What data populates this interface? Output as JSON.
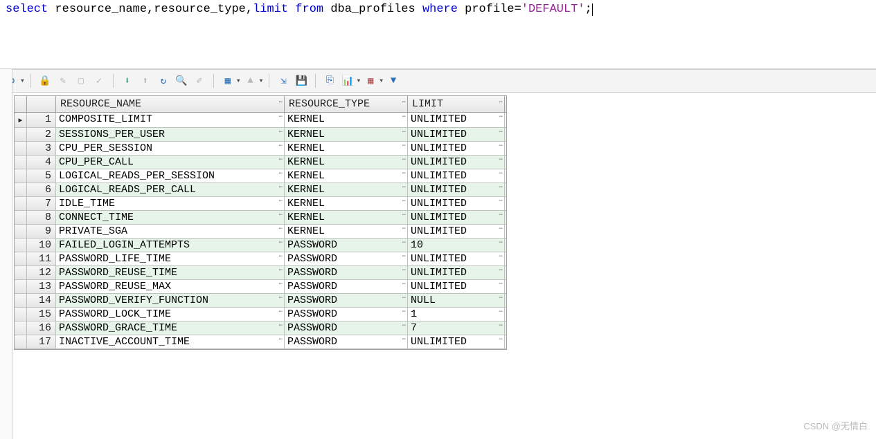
{
  "sql": {
    "tokens": [
      {
        "t": "select ",
        "c": "kw"
      },
      {
        "t": "resource_name,resource_type,",
        "c": "plain"
      },
      {
        "t": "limit ",
        "c": "kw"
      },
      {
        "t": "from ",
        "c": "kw"
      },
      {
        "t": "dba_profiles ",
        "c": "plain"
      },
      {
        "t": "where ",
        "c": "kw"
      },
      {
        "t": "profile=",
        "c": "plain"
      },
      {
        "t": "'DEFAULT'",
        "c": "str"
      },
      {
        "t": ";",
        "c": "plain"
      }
    ]
  },
  "toolbar": {
    "buttons": [
      {
        "name": "gear-icon",
        "color": "#2a6fb5",
        "char": "⚙",
        "drop": true
      },
      {
        "sep": true
      },
      {
        "name": "lock-icon",
        "color": "#b02020",
        "char": "🔒"
      },
      {
        "name": "edit-icon",
        "color": "#b8b8b8",
        "char": "✎"
      },
      {
        "name": "box-icon",
        "color": "#b8b8b8",
        "char": "▢"
      },
      {
        "name": "check-icon",
        "color": "#b8b8b8",
        "char": "✓"
      },
      {
        "sep": true
      },
      {
        "name": "down-icon",
        "color": "#4a8",
        "char": "⬇"
      },
      {
        "name": "up-icon",
        "color": "#b8b8b8",
        "char": "⬆"
      },
      {
        "name": "reload-icon",
        "color": "#2a6fb5",
        "char": "↻"
      },
      {
        "name": "find-icon",
        "color": "#2a6fb5",
        "char": "🔍"
      },
      {
        "name": "brush-icon",
        "color": "#b8b8b8",
        "char": "✐"
      },
      {
        "sep": true
      },
      {
        "name": "form-icon",
        "color": "#2a6fb5",
        "char": "▦",
        "drop": true
      },
      {
        "name": "nav-up-icon",
        "color": "#b8b8b8",
        "char": "▲",
        "drop": true
      },
      {
        "sep": true
      },
      {
        "name": "export-icon",
        "color": "#2a6fb5",
        "char": "⇲"
      },
      {
        "name": "save-icon",
        "color": "#3a6",
        "char": "💾"
      },
      {
        "sep": true
      },
      {
        "name": "copy-icon",
        "color": "#2a6fb5",
        "char": "⎘"
      },
      {
        "name": "chart-icon",
        "color": "#e07000",
        "char": "📊",
        "drop": true
      },
      {
        "name": "grid-icon",
        "color": "#b05050",
        "char": "▦",
        "drop": true
      },
      {
        "name": "funnel-icon",
        "color": "#2a6fb5",
        "char": "▼"
      }
    ]
  },
  "grid": {
    "columns": [
      {
        "key": "RESOURCE_NAME",
        "label": "RESOURCE_NAME",
        "class": "c-name"
      },
      {
        "key": "RESOURCE_TYPE",
        "label": "RESOURCE_TYPE",
        "class": "c-type"
      },
      {
        "key": "LIMIT",
        "label": "LIMIT",
        "class": "c-limit"
      }
    ],
    "rows": [
      {
        "RESOURCE_NAME": "COMPOSITE_LIMIT",
        "RESOURCE_TYPE": "KERNEL",
        "LIMIT": "UNLIMITED"
      },
      {
        "RESOURCE_NAME": "SESSIONS_PER_USER",
        "RESOURCE_TYPE": "KERNEL",
        "LIMIT": "UNLIMITED"
      },
      {
        "RESOURCE_NAME": "CPU_PER_SESSION",
        "RESOURCE_TYPE": "KERNEL",
        "LIMIT": "UNLIMITED"
      },
      {
        "RESOURCE_NAME": "CPU_PER_CALL",
        "RESOURCE_TYPE": "KERNEL",
        "LIMIT": "UNLIMITED"
      },
      {
        "RESOURCE_NAME": "LOGICAL_READS_PER_SESSION",
        "RESOURCE_TYPE": "KERNEL",
        "LIMIT": "UNLIMITED"
      },
      {
        "RESOURCE_NAME": "LOGICAL_READS_PER_CALL",
        "RESOURCE_TYPE": "KERNEL",
        "LIMIT": "UNLIMITED"
      },
      {
        "RESOURCE_NAME": "IDLE_TIME",
        "RESOURCE_TYPE": "KERNEL",
        "LIMIT": "UNLIMITED"
      },
      {
        "RESOURCE_NAME": "CONNECT_TIME",
        "RESOURCE_TYPE": "KERNEL",
        "LIMIT": "UNLIMITED"
      },
      {
        "RESOURCE_NAME": "PRIVATE_SGA",
        "RESOURCE_TYPE": "KERNEL",
        "LIMIT": "UNLIMITED"
      },
      {
        "RESOURCE_NAME": "FAILED_LOGIN_ATTEMPTS",
        "RESOURCE_TYPE": "PASSWORD",
        "LIMIT": "10"
      },
      {
        "RESOURCE_NAME": "PASSWORD_LIFE_TIME",
        "RESOURCE_TYPE": "PASSWORD",
        "LIMIT": "UNLIMITED"
      },
      {
        "RESOURCE_NAME": "PASSWORD_REUSE_TIME",
        "RESOURCE_TYPE": "PASSWORD",
        "LIMIT": "UNLIMITED"
      },
      {
        "RESOURCE_NAME": "PASSWORD_REUSE_MAX",
        "RESOURCE_TYPE": "PASSWORD",
        "LIMIT": "UNLIMITED"
      },
      {
        "RESOURCE_NAME": "PASSWORD_VERIFY_FUNCTION",
        "RESOURCE_TYPE": "PASSWORD",
        "LIMIT": "NULL"
      },
      {
        "RESOURCE_NAME": "PASSWORD_LOCK_TIME",
        "RESOURCE_TYPE": "PASSWORD",
        "LIMIT": "1"
      },
      {
        "RESOURCE_NAME": "PASSWORD_GRACE_TIME",
        "RESOURCE_TYPE": "PASSWORD",
        "LIMIT": "7"
      },
      {
        "RESOURCE_NAME": "INACTIVE_ACCOUNT_TIME",
        "RESOURCE_TYPE": "PASSWORD",
        "LIMIT": "UNLIMITED"
      }
    ],
    "current_row_marker": "▸"
  },
  "watermark": "CSDN @无情白"
}
